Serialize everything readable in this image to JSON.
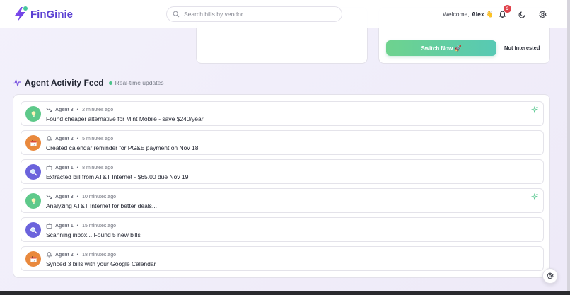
{
  "app": {
    "name": "FinGinie"
  },
  "search": {
    "placeholder": "Search bills by vendor..."
  },
  "header": {
    "welcome": "Welcome,",
    "user": "Alex 👋",
    "notification_count": "3"
  },
  "offer": {
    "switch_label": "Switch Now 🚀",
    "decline_label": "Not Interested"
  },
  "feed": {
    "title": "Agent Activity Feed",
    "live_label": "Real-time updates",
    "items": [
      {
        "agent": "Agent 3",
        "time": "2 minutes ago",
        "message": "Found cheaper alternative for Mint Mobile - save $240/year",
        "kind": "trend"
      },
      {
        "agent": "Agent 2",
        "time": "5 minutes ago",
        "message": "Created calendar reminder for PG&E payment on Nov 18",
        "kind": "bell"
      },
      {
        "agent": "Agent 1",
        "time": "8 minutes ago",
        "message": "Extracted bill from AT&T Internet - $65.00 due Nov 19",
        "kind": "bot"
      },
      {
        "agent": "Agent 3",
        "time": "10 minutes ago",
        "message": "Analyzing AT&T Internet for better deals...",
        "kind": "trend"
      },
      {
        "agent": "Agent 1",
        "time": "15 minutes ago",
        "message": "Scanning inbox... Found 5 new bills",
        "kind": "bot"
      },
      {
        "agent": "Agent 2",
        "time": "18 minutes ago",
        "message": "Synced 3 bills with your Google Calendar",
        "kind": "bell"
      }
    ]
  },
  "colors": {
    "brand": "#5a3fd3",
    "green": "#5ec98a",
    "orange": "#e9893d",
    "purple": "#6b63dc",
    "badge": "#e0424b"
  }
}
